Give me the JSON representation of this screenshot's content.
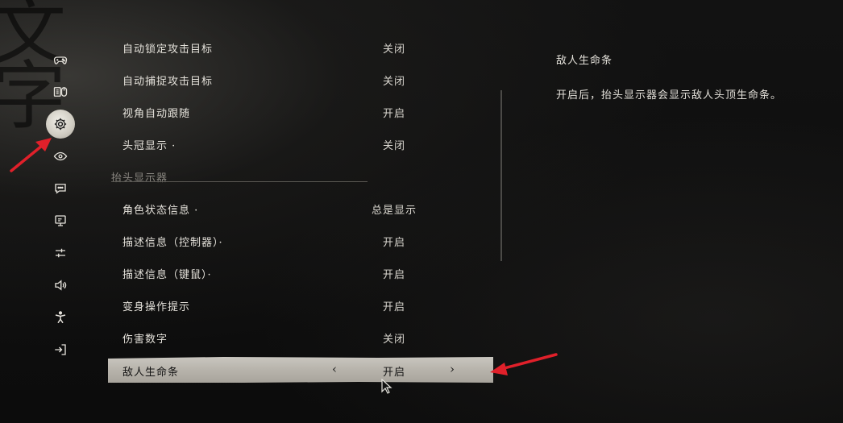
{
  "sidebar": {
    "items": [
      {
        "icon": "gamepad-icon"
      },
      {
        "icon": "keyboard-mouse-icon"
      },
      {
        "icon": "gear-icon"
      },
      {
        "icon": "eye-icon"
      },
      {
        "icon": "chat-icon"
      },
      {
        "icon": "monitor-icon"
      },
      {
        "icon": "sliders-icon"
      },
      {
        "icon": "speaker-icon"
      },
      {
        "icon": "accessibility-icon"
      },
      {
        "icon": "exit-icon"
      }
    ],
    "active_index": 2
  },
  "settings": {
    "rows_top": [
      {
        "label": "自动锁定攻击目标",
        "value": "关闭"
      },
      {
        "label": "自动捕捉攻击目标",
        "value": "关闭"
      },
      {
        "label": "视角自动跟随",
        "value": "开启"
      },
      {
        "label": "头冠显示 ·",
        "value": "关闭"
      }
    ],
    "section_title": "抬头显示器",
    "rows_hud": [
      {
        "label": "角色状态信息 ·",
        "value": "总是显示"
      },
      {
        "label": "描述信息（控制器）·",
        "value": "开启"
      },
      {
        "label": "描述信息（键鼠）·",
        "value": "开启"
      },
      {
        "label": "变身操作提示",
        "value": "开启"
      },
      {
        "label": "伤害数字",
        "value": "关闭"
      }
    ],
    "selected_row": {
      "label": "敌人生命条",
      "value": "开启",
      "left_arrow": "‹",
      "right_arrow": "›"
    }
  },
  "description": {
    "title": "敌人生命条",
    "body": "开启后，抬头显示器会显示敌人头顶生命条。"
  },
  "colors": {
    "annotation_arrow": "#e0202a",
    "selected_bg": "#bdb9b1",
    "text": "#e4e1da"
  }
}
